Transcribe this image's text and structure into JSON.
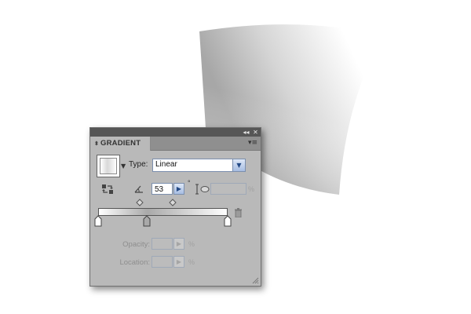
{
  "panel": {
    "collapse_glyph": "◂◂",
    "close_glyph": "✕",
    "tab_arrows": "⬍",
    "tab_title": "GRADIENT",
    "menu_glyph": "▾≡",
    "swatch_dropdown_glyph": "▼",
    "type_label": "Type:",
    "type_value": "Linear",
    "dropdown_glyph": "▼",
    "angle_value": "53",
    "angle_step_glyph": "▶",
    "degree_sign": "°",
    "aspect_value": "",
    "aspect_unit": "%",
    "opacity_label": "Opacity:",
    "opacity_value": "",
    "opacity_unit": "%",
    "location_label": "Location:",
    "location_value": "",
    "location_unit": "%"
  },
  "gradient": {
    "type": "linear",
    "angle_deg": 53,
    "stops": [
      {
        "color": "#ffffff",
        "location": 0
      },
      {
        "color": "#a9a9a9",
        "location": 38
      },
      {
        "color": "#ffffff",
        "location": 100
      }
    ],
    "midpoints": [
      32,
      57
    ]
  },
  "colors": {
    "panel_bg": "#b9b9b9",
    "titlebar": "#565656",
    "input_border": "#7b8fae"
  },
  "icons": [
    "reverse-gradient-icon",
    "angle-icon",
    "aspect-ratio-icon",
    "trash-icon",
    "resize-grip-icon"
  ]
}
